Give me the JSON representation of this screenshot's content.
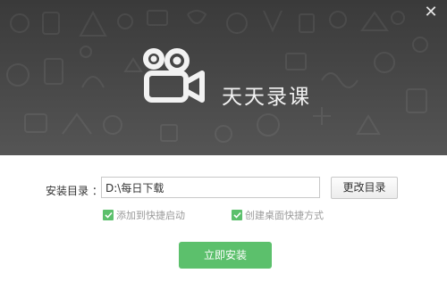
{
  "header": {
    "app_title": "天天录课",
    "close_label": "✕"
  },
  "install": {
    "dir_label": "安装目录 ：",
    "dir_value": "D:\\每日下载",
    "change_dir_label": "更改目录",
    "options": [
      {
        "label": "添加到快捷启动",
        "checked": true
      },
      {
        "label": "创建桌面快捷方式",
        "checked": true
      }
    ],
    "install_button_label": "立即安装"
  },
  "colors": {
    "header_bg": "#444444",
    "accent_green": "#5cc06c",
    "text": "#333333"
  },
  "icons": {
    "logo": "video-camera-icon",
    "close": "close-icon",
    "check": "check-icon"
  }
}
